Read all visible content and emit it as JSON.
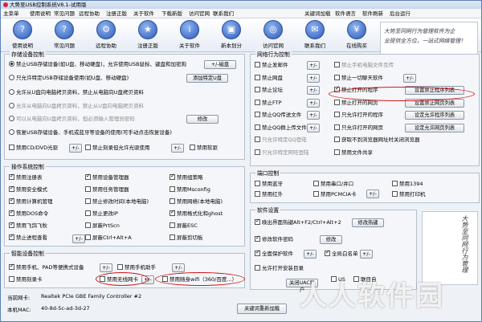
{
  "titlebar": {
    "title": "大势至USB控制系统V8.1-试用版"
  },
  "menu": {
    "left": [
      "主菜单",
      "使用说明",
      "常见问题",
      "远程协助",
      "注册正版",
      "关于软件",
      "下载新版",
      "访问官网",
      "联系我们"
    ],
    "right": [
      "关键词加载",
      "软件语言",
      "软件刷新",
      "后台运行"
    ]
  },
  "toolbar": [
    {
      "label": "使用说明",
      "icon": "book-icon",
      "glyph": "?"
    },
    {
      "label": "常见问题",
      "icon": "question-icon",
      "glyph": "?"
    },
    {
      "label": "远程协助",
      "icon": "remote-icon",
      "glyph": "⚙"
    },
    {
      "label": "注册正版",
      "icon": "key-icon",
      "glyph": "★"
    },
    {
      "label": "关于软件",
      "icon": "info-icon",
      "glyph": "i"
    },
    {
      "label": "新本划分",
      "icon": "monitor-icon",
      "glyph": "▣"
    },
    {
      "label": "访问官网",
      "icon": "globe-icon",
      "glyph": "◎"
    },
    {
      "label": "联系我们",
      "icon": "contact-icon",
      "glyph": "✉"
    },
    {
      "label": "在线购买",
      "icon": "cart-icon",
      "glyph": "¥"
    }
  ],
  "banner": {
    "line1": "大势至同网行为管理软件为企",
    "line2": "业提供全方位，一站式网络管理！"
  },
  "storage": {
    "title": "存储设备控制",
    "opt1": "禁止USB存储设备(如U盘、移动硬盘)，允许使用USB鼠标、键盘和加密狗",
    "opt1_btn": "+/-磁盘",
    "opt2": "只允许特定USB存储设备使用(如U盘、移动硬盘)",
    "opt2_btn": "添加特定U盘",
    "opt3": "允许从U盘向电脑拷贝资料，禁止从电脑向U盘拷贝资料",
    "opt4": "允许从电脑向U盘拷贝资料，禁止从U盘向电脑拷贝资料",
    "opt5": "可以从电脑向U盘拷贝资料，但必须输入管理员密码",
    "opt5_btn": "修改",
    "opt6": "恢复USB存储设备、手机或蓝牙等设备的使用(可手动点击恢复设备)",
    "cd": "禁用CD/DVD光驱",
    "cd_btn": "+/-",
    "cd2": "禁止刻录但允许光驱使用",
    "cd2_btn": "+/-",
    "floppy": "禁用软驱"
  },
  "os": {
    "title": "操作系统控制",
    "items": [
      [
        "禁用注册表",
        "禁用设备管理器",
        "禁用组策略"
      ],
      [
        "禁用安全模式",
        "禁用任务管理器",
        "禁用Msconfig"
      ],
      [
        "禁用计算机管理",
        "禁止修改时间(本地电脑)",
        "禁用网络(本地电脑)"
      ],
      [
        "禁用DOS命令",
        "禁止更改IP",
        "禁用格式化和ghost"
      ],
      [
        "禁用飞鸽飞秋",
        "屏蔽PrtScn",
        "屏蔽ESC"
      ],
      [
        "禁止进程查看",
        "屏蔽Ctrl+Alt+A",
        "屏蔽剪切板"
      ]
    ],
    "btn1": "+/-",
    "btn2": "+/-"
  },
  "smart": {
    "title": "智能设备控制",
    "phone": "禁用手机、PAD等便携式设备",
    "phone_btn": "+/-",
    "assist": "禁用手机助手",
    "assist_btn": "+/-",
    "card": "禁用刻录卡",
    "wifi_nic": "禁用无线网卡",
    "wifi_btn": "+/-",
    "wifi_hot": "禁用随身wifi（360/百度...）"
  },
  "info": {
    "nic_label": "当前网卡:",
    "nic_value": "Realtek PCIe GBE Family Controller #2",
    "mac_label": "本机MAC:",
    "mac_value": "40-8d-5c-ad-3d-27"
  },
  "network": {
    "title": "网络行为控制",
    "rows": [
      {
        "a": "禁止发邮件",
        "a_on": false,
        "b": "禁止手机电脑文件互传",
        "b_on": false,
        "b_gray": true
      },
      {
        "a": "禁止网盘",
        "a_on": false,
        "b": "禁止一切聊天软件",
        "b_on": false
      },
      {
        "a": "禁止论坛",
        "a_on": false,
        "b": "禁止打开的程序",
        "b_on": true,
        "b_btn": "设置禁止程序列表"
      },
      {
        "a": "禁止FTP",
        "a_on": false,
        "b": "禁止打开的网页",
        "b_on": false,
        "b_btn": "设置禁止网页列表"
      },
      {
        "a": "禁止QQ传送文件",
        "a_on": false,
        "b": "只允许打开的程序",
        "b_on": false,
        "b_btn": "设定允许程序列表"
      },
      {
        "a": "禁止QQ群上传文件",
        "a_on": false,
        "b": "只允许打开的网页",
        "b_on": false,
        "b_btn": "设定允许网页列表"
      },
      {
        "a": "只允许特定QQ登陆",
        "a_on": false,
        "a_gray": true,
        "b": "获取不到浏览器网址时关闭浏览器",
        "b_on": false
      },
      {
        "a": "只允许特定阿旺登陆",
        "a_on": false,
        "a_gray": true,
        "b": "禁用文件共享",
        "b_on": false
      }
    ],
    "btns": [
      "+/-",
      "+/-",
      "+/-",
      "+/-",
      "+/-",
      "+/-"
    ]
  },
  "port": {
    "title": "端口控制",
    "items": [
      [
        "禁用蓝牙",
        "禁用串口/并口",
        "禁用1394"
      ],
      [
        "禁用红外",
        "禁用PCMCIA卡",
        "禁用打印机"
      ]
    ],
    "btn": "+/-"
  },
  "settings": {
    "title": "软件设置",
    "hotkey": "唤出界面热键Alt+F2/Ctrl+Alt+2",
    "hotkey_btn": "修改热键",
    "pwd": "修改软件密码",
    "pwd_btn": "修改",
    "protect": "全面保护软件",
    "protect_btn": "+/-",
    "whitelist": "全局白名单",
    "whitelist_btn": "+/-",
    "allow": "允许打开安装目录",
    "uac_btn": "关闭UAC账户",
    "us": "US",
    "chk2": "联目自"
  },
  "footer_btn": "关键词重新加载",
  "sidebanner": "大势至同网行为管理",
  "watermark": "人人软件园",
  "colors": {
    "accent": "#2c58b8",
    "highlight": "#d01818"
  }
}
